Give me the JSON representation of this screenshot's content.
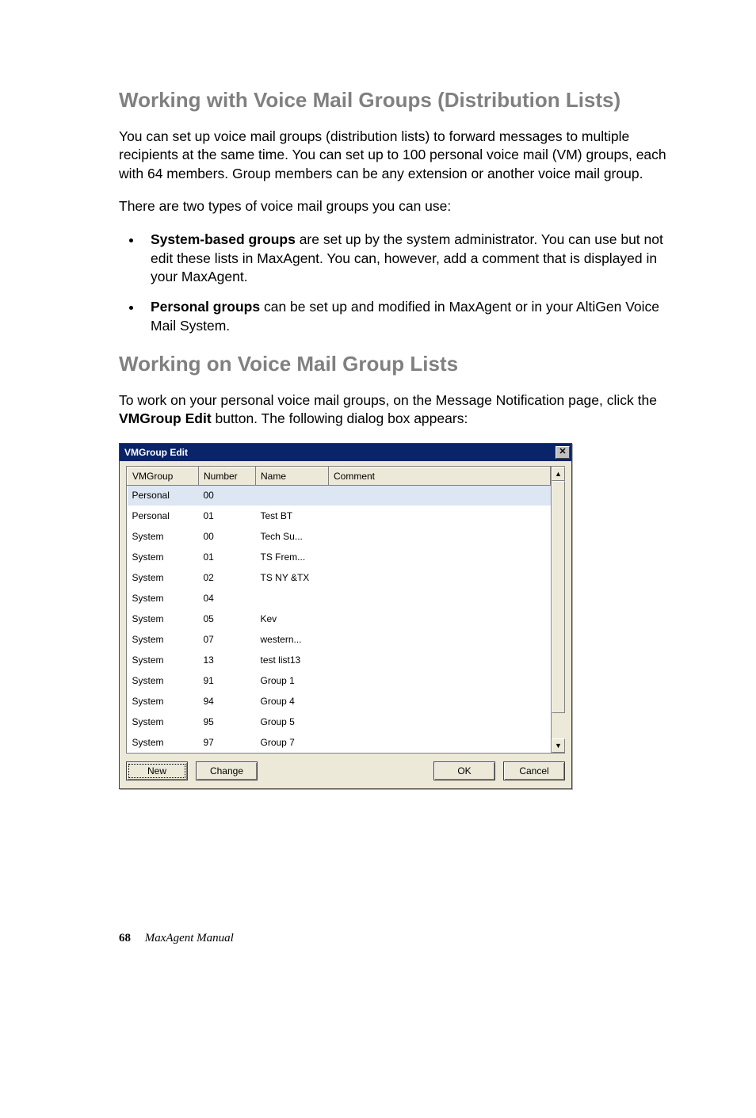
{
  "headings": {
    "h1": "Working with Voice Mail Groups (Distribution Lists)",
    "h2": "Working on Voice Mail Group Lists"
  },
  "paragraphs": {
    "p1": "You can set up voice mail groups (distribution lists) to forward messages to multiple recipients at the same time. You can set up to 100 personal voice mail (VM) groups, each with 64 members. Group members can be any extension or another voice mail group.",
    "p2": "There are two types of voice mail groups you can use:",
    "p3_pre": "To work on your personal voice mail groups, on the Message Notification page, click the ",
    "p3_bold": "VMGroup Edit",
    "p3_post": " button. The following dialog box appears:"
  },
  "bullets": {
    "b1_bold": "System-based groups",
    "b1_rest": " are set up by the system administrator. You can use but not edit these lists in MaxAgent. You can, however, add a comment that is displayed in your MaxAgent.",
    "b2_bold": "Personal groups",
    "b2_rest": " can be set up and modified in MaxAgent or in your AltiGen Voice Mail System."
  },
  "dialog": {
    "title": "VMGroup Edit",
    "columns": {
      "c1": "VMGroup",
      "c2": "Number",
      "c3": "Name",
      "c4": "Comment"
    },
    "rows": [
      {
        "group": "Personal",
        "number": "00",
        "name": "",
        "comment": "",
        "selected": true
      },
      {
        "group": "Personal",
        "number": "01",
        "name": "Test BT",
        "comment": "",
        "selected": false
      },
      {
        "group": "System",
        "number": "00",
        "name": "Tech Su...",
        "comment": "",
        "selected": false
      },
      {
        "group": "System",
        "number": "01",
        "name": "TS Frem...",
        "comment": "",
        "selected": false
      },
      {
        "group": "System",
        "number": "02",
        "name": "TS NY &TX",
        "comment": "",
        "selected": false
      },
      {
        "group": "System",
        "number": "04",
        "name": "",
        "comment": "",
        "selected": false
      },
      {
        "group": "System",
        "number": "05",
        "name": "Kev",
        "comment": "",
        "selected": false
      },
      {
        "group": "System",
        "number": "07",
        "name": "western...",
        "comment": "",
        "selected": false
      },
      {
        "group": "System",
        "number": "13",
        "name": "test list13",
        "comment": "",
        "selected": false
      },
      {
        "group": "System",
        "number": "91",
        "name": "Group 1",
        "comment": "",
        "selected": false
      },
      {
        "group": "System",
        "number": "94",
        "name": "Group 4",
        "comment": "",
        "selected": false
      },
      {
        "group": "System",
        "number": "95",
        "name": "Group 5",
        "comment": "",
        "selected": false
      },
      {
        "group": "System",
        "number": "97",
        "name": "Group 7",
        "comment": "",
        "selected": false
      }
    ],
    "buttons": {
      "new": "New",
      "change": "Change",
      "ok": "OK",
      "cancel": "Cancel"
    },
    "close_glyph": "✕",
    "scroll_up": "▲",
    "scroll_down": "▼"
  },
  "footer": {
    "page": "68",
    "title": "MaxAgent Manual"
  }
}
